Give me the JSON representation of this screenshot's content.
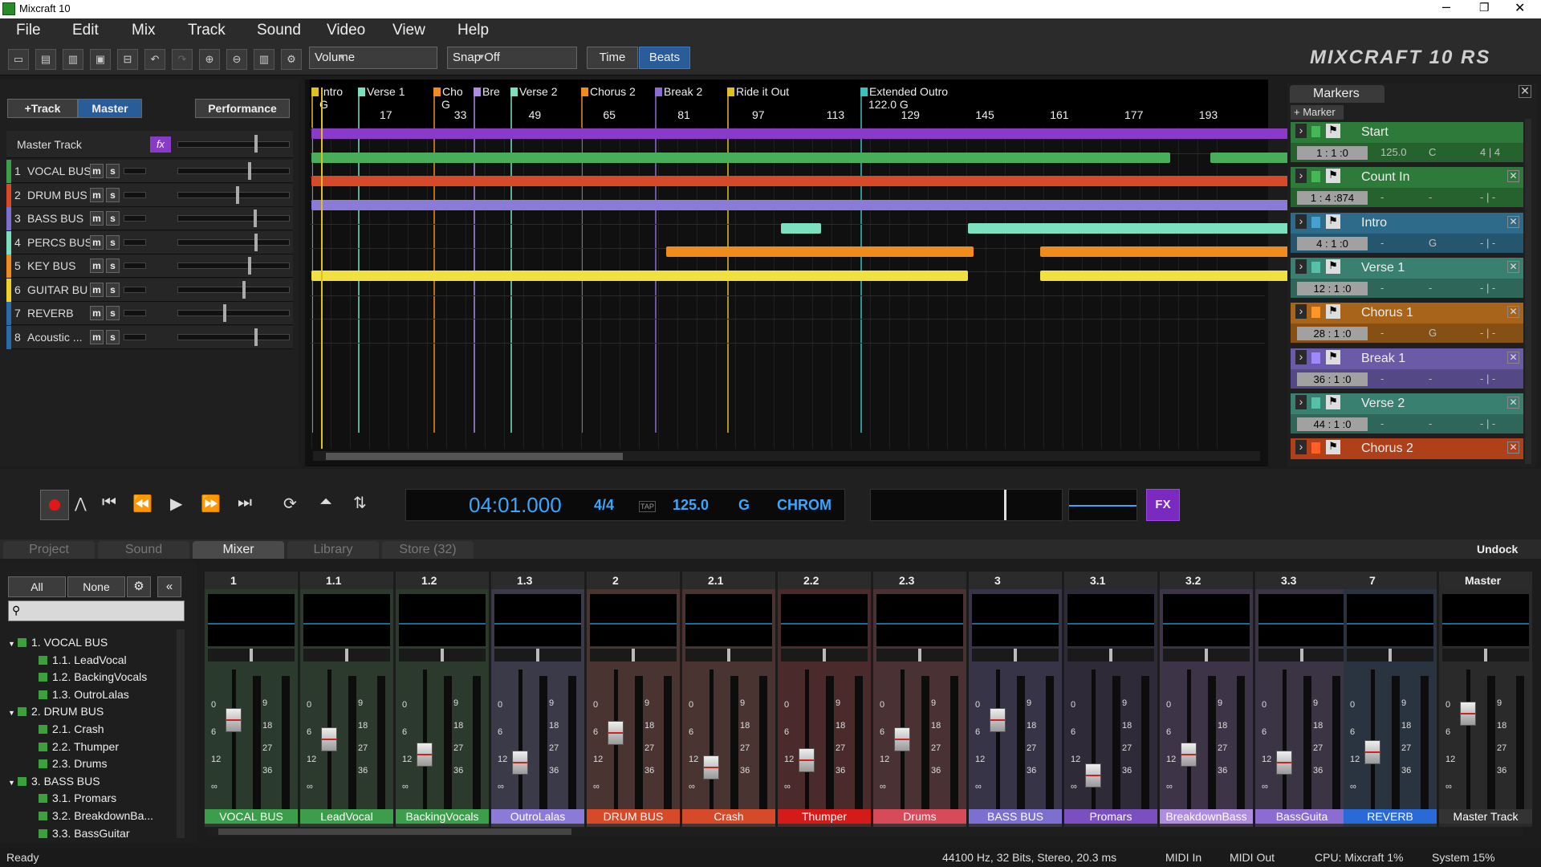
{
  "window": {
    "title": "Mixcraft 10"
  },
  "menu": [
    "File",
    "Edit",
    "Mix",
    "Track",
    "Sound",
    "Video",
    "View",
    "Help"
  ],
  "toolbar": {
    "volume_dd": "Volume",
    "snap_dd": "Snap Off",
    "time_btn": "Time",
    "beats_btn": "Beats",
    "logo": "MIXCRAFT 10 RS"
  },
  "trackpanel": {
    "add_track": "+Track",
    "master": "Master",
    "performance": "Performance",
    "master_track": "Master Track",
    "fx": "fx",
    "tracks": [
      {
        "num": "1",
        "name": "VOCAL BUS",
        "color": "#3c9d4a"
      },
      {
        "num": "2",
        "name": "DRUM BUS",
        "color": "#d64a2a"
      },
      {
        "num": "3",
        "name": "BASS BUS",
        "color": "#7c6fd0"
      },
      {
        "num": "4",
        "name": "PERCS BUS",
        "color": "#7ce0c0"
      },
      {
        "num": "5",
        "name": "KEY BUS",
        "color": "#f08c1e"
      },
      {
        "num": "6",
        "name": "GUITAR BU",
        "color": "#f0d02a"
      },
      {
        "num": "7",
        "name": "REVERB",
        "color": "#2a6aa8"
      },
      {
        "num": "8",
        "name": "Acoustic ...",
        "color": "#2a6aa8"
      }
    ],
    "m": "m",
    "s": "s"
  },
  "timeline": {
    "markers": [
      {
        "label": "Intro",
        "sub": "G",
        "color": "#e0c020"
      },
      {
        "label": "Verse 1",
        "sub": "",
        "color": "#7ce0c0"
      },
      {
        "label": "Cho",
        "sub": "G",
        "color": "#f08c1e"
      },
      {
        "label": "Bre",
        "sub": "",
        "color": "#b08ce0"
      },
      {
        "label": "Verse 2",
        "sub": "",
        "color": "#7ce0c0"
      },
      {
        "label": "Chorus 2",
        "sub": "",
        "color": "#f08c1e"
      },
      {
        "label": "Break 2",
        "sub": "",
        "color": "#8c6cd0"
      },
      {
        "label": "Ride it Out",
        "sub": "",
        "color": "#e0c020"
      },
      {
        "label": "Extended Outro",
        "sub": "122.0 G",
        "color": "#3cc0c0"
      }
    ],
    "ruler": [
      "17",
      "33",
      "49",
      "65",
      "81",
      "97",
      "113",
      "129",
      "145",
      "161",
      "177",
      "193"
    ]
  },
  "markers_panel": {
    "tab": "Markers",
    "add": "+ Marker",
    "items": [
      {
        "name": "Start",
        "pos": "1 : 1 :0",
        "v1": "125.0",
        "v2": "C",
        "v3": "4 | 4",
        "color": "#2e7a3a"
      },
      {
        "name": "Count In",
        "pos": "1 : 4 :874",
        "v1": "-",
        "v2": "-",
        "v3": "- | -",
        "color": "#2e7a3a"
      },
      {
        "name": "Intro",
        "pos": "4 : 1 :0",
        "v1": "-",
        "v2": "G",
        "v3": "- | -",
        "color": "#2e6b8a"
      },
      {
        "name": "Verse 1",
        "pos": "12 : 1 :0",
        "v1": "-",
        "v2": "-",
        "v3": "- | -",
        "color": "#3a8070"
      },
      {
        "name": "Chorus 1",
        "pos": "28 : 1 :0",
        "v1": "-",
        "v2": "G",
        "v3": "- | -",
        "color": "#a8641a"
      },
      {
        "name": "Break 1",
        "pos": "36 : 1 :0",
        "v1": "-",
        "v2": "-",
        "v3": "- | -",
        "color": "#6a5aa8"
      },
      {
        "name": "Verse 2",
        "pos": "44 : 1 :0",
        "v1": "-",
        "v2": "-",
        "v3": "- | -",
        "color": "#3a8070"
      },
      {
        "name": "Chorus 2",
        "pos": "",
        "v1": "",
        "v2": "",
        "v3": "",
        "color": "#b0401a"
      }
    ]
  },
  "transport": {
    "time": "04:01.000",
    "sig": "4/4",
    "tap": "TAP",
    "bpm": "125.0",
    "key": "G",
    "scale": "CHROM",
    "fx": "FX"
  },
  "tabs": {
    "project": "Project",
    "sound": "Sound",
    "mixer": "Mixer",
    "library": "Library",
    "store": "Store (32)",
    "undock": "Undock"
  },
  "mixer_left": {
    "all": "All",
    "none": "None",
    "tree": [
      {
        "t": "1. VOCAL BUS",
        "lvl": 0
      },
      {
        "t": "1.1. LeadVocal",
        "lvl": 1
      },
      {
        "t": "1.2. BackingVocals",
        "lvl": 1
      },
      {
        "t": "1.3. OutroLalas",
        "lvl": 1
      },
      {
        "t": "2. DRUM BUS",
        "lvl": 0
      },
      {
        "t": "2.1. Crash",
        "lvl": 1
      },
      {
        "t": "2.2. Thumper",
        "lvl": 1
      },
      {
        "t": "2.3. Drums",
        "lvl": 1
      },
      {
        "t": "3. BASS BUS",
        "lvl": 0
      },
      {
        "t": "3.1. Promars",
        "lvl": 1
      },
      {
        "t": "3.2. BreakdownBa...",
        "lvl": 1
      },
      {
        "t": "3.3. BassGuitar",
        "lvl": 1
      }
    ]
  },
  "scale_left": [
    "0",
    "6",
    "12",
    "∞"
  ],
  "scale_right": [
    "9",
    "18",
    "27",
    "36"
  ],
  "channels": [
    {
      "id": "1",
      "name": "VOCAL BUS",
      "bg": "#2a3a2c",
      "foot": "#3c9d4a",
      "fader": 0.25
    },
    {
      "id": "1.1",
      "name": "LeadVocal",
      "bg": "#2c3a2e",
      "foot": "#3c9d4a",
      "fader": 0.4
    },
    {
      "id": "1.2",
      "name": "BackingVocals",
      "bg": "#2c3a2e",
      "foot": "#3c9d4a",
      "fader": 0.52
    },
    {
      "id": "1.3",
      "name": "OutroLalas",
      "bg": "#3a3a48",
      "foot": "#8c7ad8",
      "fader": 0.58
    },
    {
      "id": "2",
      "name": "DRUM BUS",
      "bg": "#4a3432",
      "foot": "#d64a2a",
      "fader": 0.35
    },
    {
      "id": "2.1",
      "name": "Crash",
      "bg": "#4a3432",
      "foot": "#d64a2a",
      "fader": 0.62
    },
    {
      "id": "2.2",
      "name": "Thumper",
      "bg": "#4a2a2a",
      "foot": "#d61a1a",
      "fader": 0.56
    },
    {
      "id": "2.3",
      "name": "Drums",
      "bg": "#4a3234",
      "foot": "#d64a5a",
      "fader": 0.4
    },
    {
      "id": "3",
      "name": "BASS BUS",
      "bg": "#383448",
      "foot": "#7c6fd0",
      "fader": 0.25
    },
    {
      "id": "3.1",
      "name": "Promars",
      "bg": "#2e2a38",
      "foot": "#7c4fc0",
      "fader": 0.68
    },
    {
      "id": "3.2",
      "name": "BreakdownBass",
      "bg": "#3e3448",
      "foot": "#b08ce0",
      "fader": 0.52
    },
    {
      "id": "3.3",
      "name": "BassGuita",
      "bg": "#3a3444",
      "foot": "#8c6cd0",
      "fader": 0.58
    },
    {
      "id": "7",
      "name": "REVERB",
      "bg": "#2a3440",
      "foot": "#2a6ad8",
      "fader": 0.5
    },
    {
      "id": "Master",
      "name": "Master Track",
      "bg": "#2a2a2a",
      "foot": "#333333",
      "fader": 0.2
    }
  ],
  "status": {
    "ready": "Ready",
    "audio": "44100 Hz, 32 Bits, Stereo, 20.3 ms",
    "midi_in": "MIDI In",
    "midi_out": "MIDI Out",
    "cpu": "CPU: Mixcraft 1%",
    "system": "System 15%"
  }
}
